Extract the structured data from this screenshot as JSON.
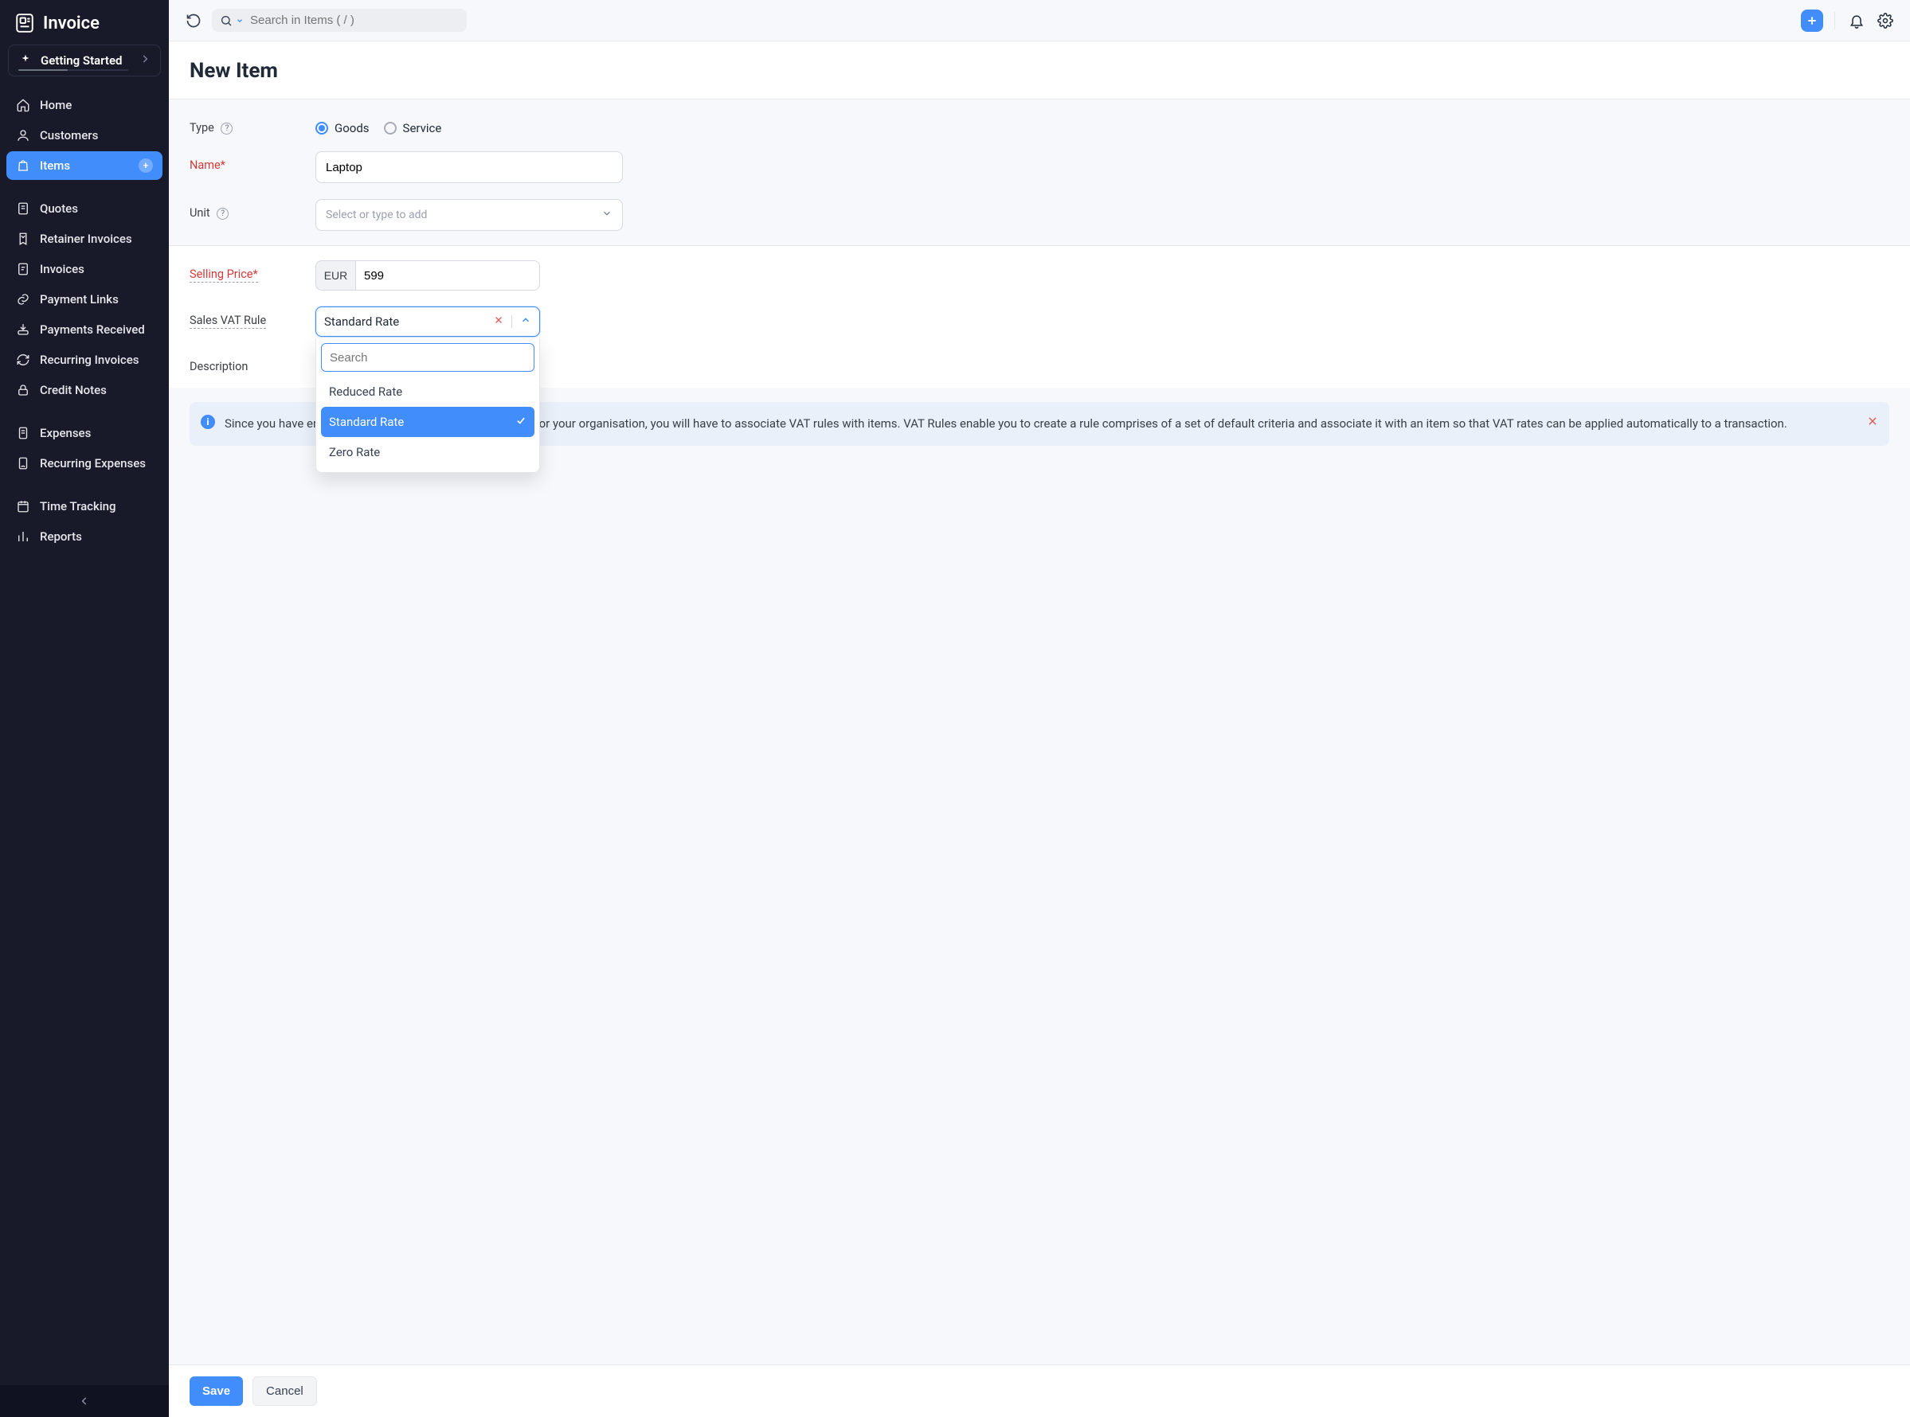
{
  "brand": {
    "title": "Invoice"
  },
  "getting_started": {
    "label": "Getting Started"
  },
  "sidebar": {
    "items": [
      {
        "id": "home",
        "label": "Home"
      },
      {
        "id": "customers",
        "label": "Customers"
      },
      {
        "id": "items",
        "label": "Items",
        "active": true,
        "add": true
      }
    ],
    "group2": [
      {
        "id": "quotes",
        "label": "Quotes"
      },
      {
        "id": "retainer",
        "label": "Retainer Invoices"
      },
      {
        "id": "invoices",
        "label": "Invoices"
      },
      {
        "id": "paylinks",
        "label": "Payment Links"
      },
      {
        "id": "payrecv",
        "label": "Payments Received"
      },
      {
        "id": "recurinv",
        "label": "Recurring Invoices"
      },
      {
        "id": "credit",
        "label": "Credit Notes"
      }
    ],
    "group3": [
      {
        "id": "expenses",
        "label": "Expenses"
      },
      {
        "id": "recurexp",
        "label": "Recurring Expenses"
      }
    ],
    "group4": [
      {
        "id": "time",
        "label": "Time Tracking"
      },
      {
        "id": "reports",
        "label": "Reports"
      }
    ]
  },
  "topbar": {
    "search_placeholder": "Search in Items ( / )"
  },
  "page": {
    "title": "New Item"
  },
  "form": {
    "type": {
      "label": "Type",
      "goods": "Goods",
      "service": "Service",
      "value": "Goods"
    },
    "name": {
      "label": "Name*",
      "value": "Laptop"
    },
    "unit": {
      "label": "Unit",
      "placeholder": "Select or type to add"
    },
    "price": {
      "label": "Selling Price*",
      "currency": "EUR",
      "value": "599"
    },
    "vat": {
      "label": "Sales VAT Rule",
      "value": "Standard Rate",
      "search_placeholder": "Search",
      "options": [
        "Reduced Rate",
        "Standard Rate",
        "Zero Rate"
      ]
    },
    "description": {
      "label": "Description"
    }
  },
  "banner": {
    "text": "Since you have enabled VAT with domestic reverse charge for your organisation, you will have to associate VAT rules with items. VAT Rules enable you to create a rule comprises of a set of default criteria and associate it with an item so that VAT rates can be applied automatically to a transaction."
  },
  "footer": {
    "save": "Save",
    "cancel": "Cancel"
  }
}
